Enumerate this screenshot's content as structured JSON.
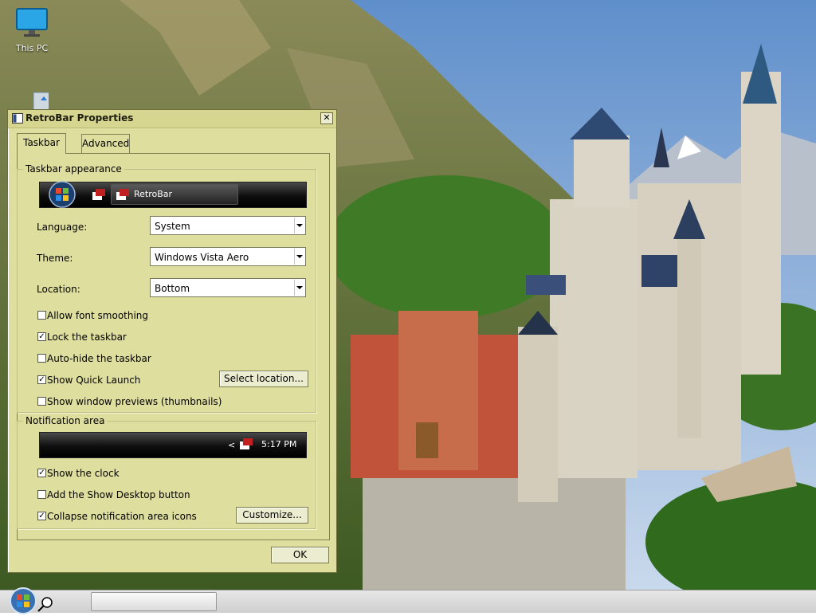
{
  "desktop": {
    "icons": [
      {
        "label": "This PC"
      },
      {
        "label": ""
      }
    ]
  },
  "dialog": {
    "title": "RetroBar Properties",
    "close_label": "✕",
    "tabs": [
      {
        "label": "Taskbar",
        "selected": true
      },
      {
        "label": "Advanced",
        "selected": false
      }
    ],
    "appearance": {
      "group_title": "Taskbar appearance",
      "preview_task_label": "RetroBar",
      "language": {
        "label": "Language:",
        "value": "System"
      },
      "theme": {
        "label": "Theme:",
        "value": "Windows Vista Aero"
      },
      "location": {
        "label": "Location:",
        "value": "Bottom"
      },
      "checks": [
        {
          "label": "Allow font smoothing",
          "checked": false
        },
        {
          "label": "Lock the taskbar",
          "checked": true
        },
        {
          "label": "Auto-hide the taskbar",
          "checked": false
        },
        {
          "label": "Show Quick Launch",
          "checked": true
        },
        {
          "label": "Show window previews (thumbnails)",
          "checked": false
        }
      ],
      "select_location_label": "Select location..."
    },
    "notification": {
      "group_title": "Notification area",
      "arrow": "<",
      "clock": "5:17 PM",
      "checks": [
        {
          "label": "Show the clock",
          "checked": true
        },
        {
          "label": "Add the Show Desktop button",
          "checked": false
        },
        {
          "label": "Collapse notification area icons",
          "checked": true
        }
      ],
      "customize_label": "Customize..."
    },
    "ok_label": "OK"
  },
  "colors": {
    "dialog_bg": "#dede9e",
    "sky": "#7fa8d6",
    "mountain": "#5b6a3a"
  }
}
